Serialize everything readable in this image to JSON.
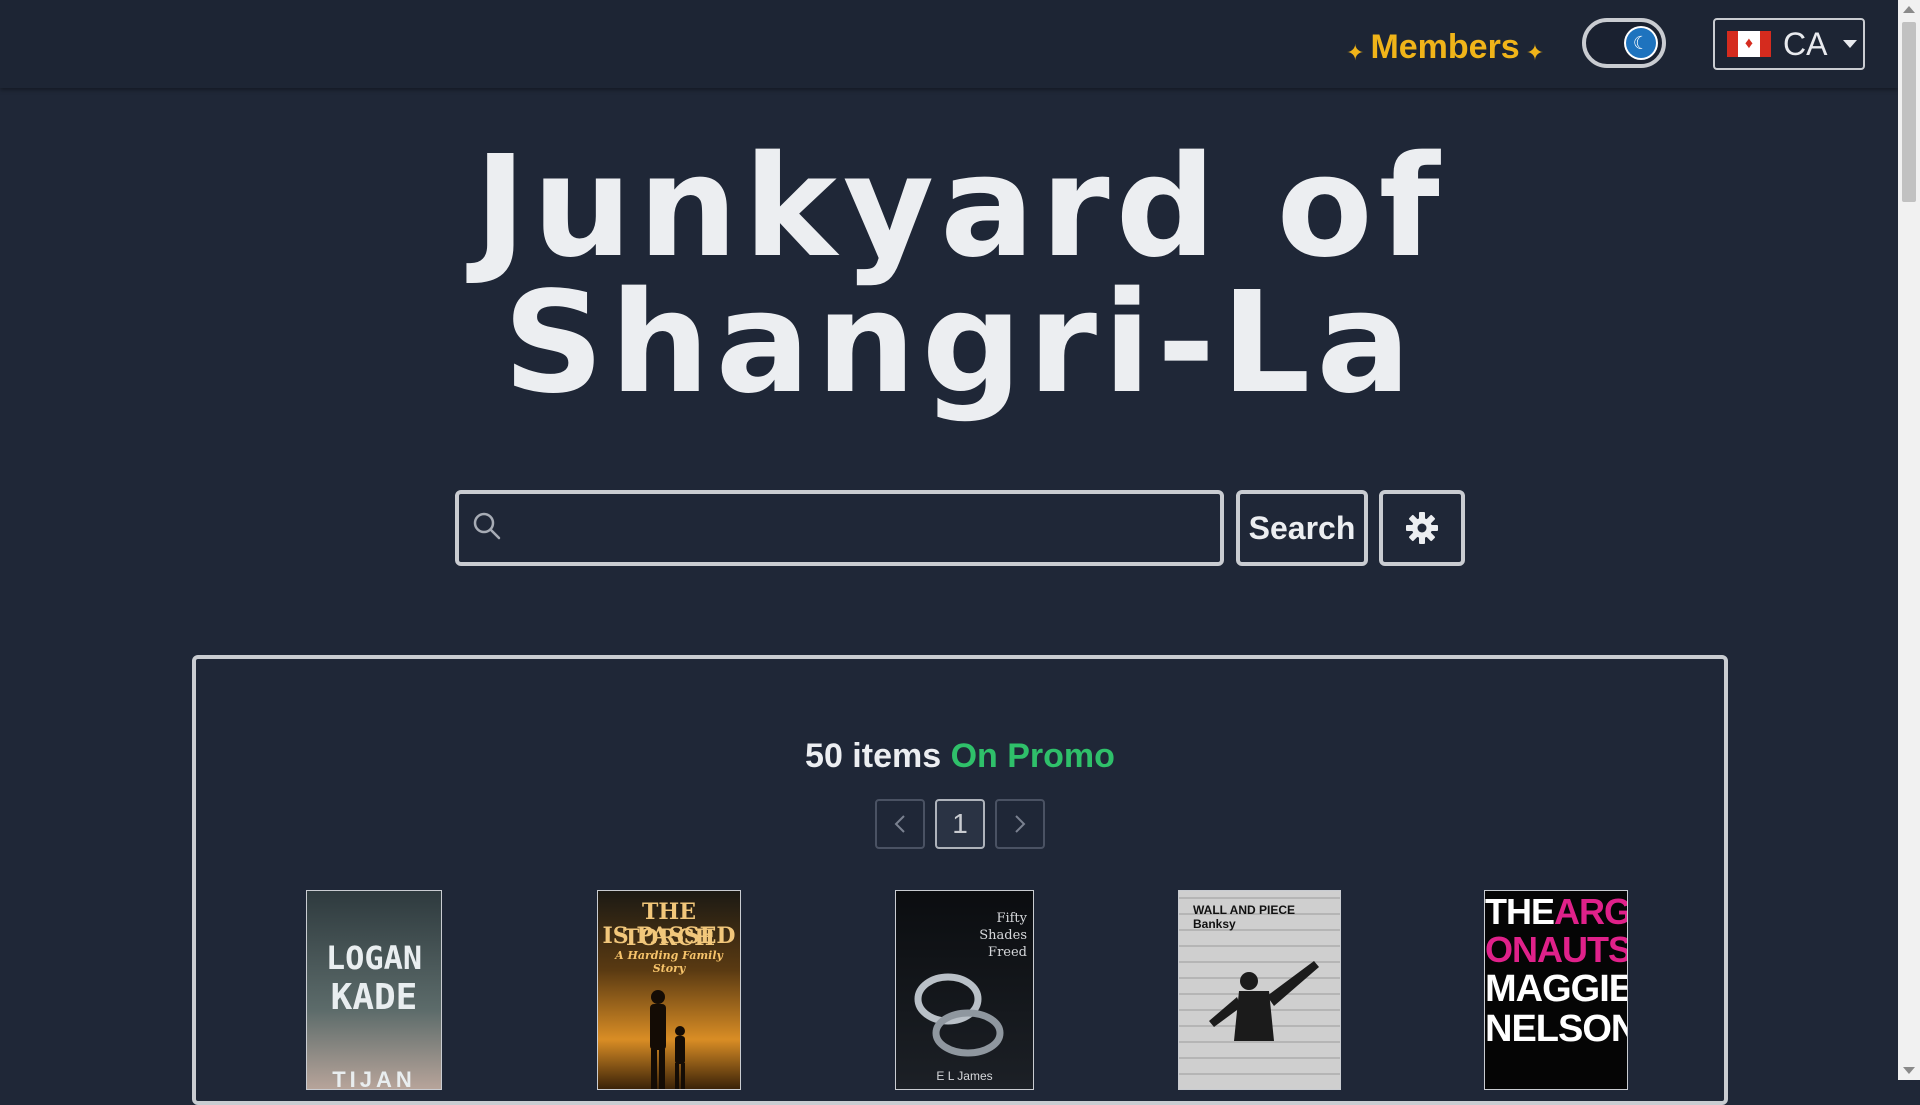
{
  "nav": {
    "members_label": "Members",
    "theme_toggle_icon": "moon-icon",
    "country_code": "CA"
  },
  "site_title_line1": "Junkyard of",
  "site_title_line2": "Shangri-La",
  "search": {
    "placeholder": "",
    "value": "",
    "button_label": "Search",
    "settings_icon": "gear-icon"
  },
  "promo": {
    "count_text": "50 items",
    "status_text": "On Promo",
    "current_page": "1"
  },
  "books": [
    {
      "title_line1": "LOGAN",
      "title_line2": "KADE",
      "bottom": "TIJAN"
    },
    {
      "title_line1": "THE TORCH",
      "title_line2": "IS PASSED",
      "subtitle": "A Harding Family Story"
    },
    {
      "title_line1": "Fifty",
      "title_line2": "Shades",
      "title_line3": "Freed",
      "author": "E L James"
    },
    {
      "title_line1": "WALL AND PIECE",
      "author": "Banksy"
    },
    {
      "title_line1": "THE",
      "title_accent": "ARG",
      "title_line2": "ONAUTS",
      "author_line1": "MAGGIE",
      "author_line2": "NELSON"
    }
  ],
  "colors": {
    "background": "#1f2737",
    "members_gold": "#f0b419",
    "promo_green": "#2fc06a",
    "toggle_blue": "#1e73be"
  }
}
